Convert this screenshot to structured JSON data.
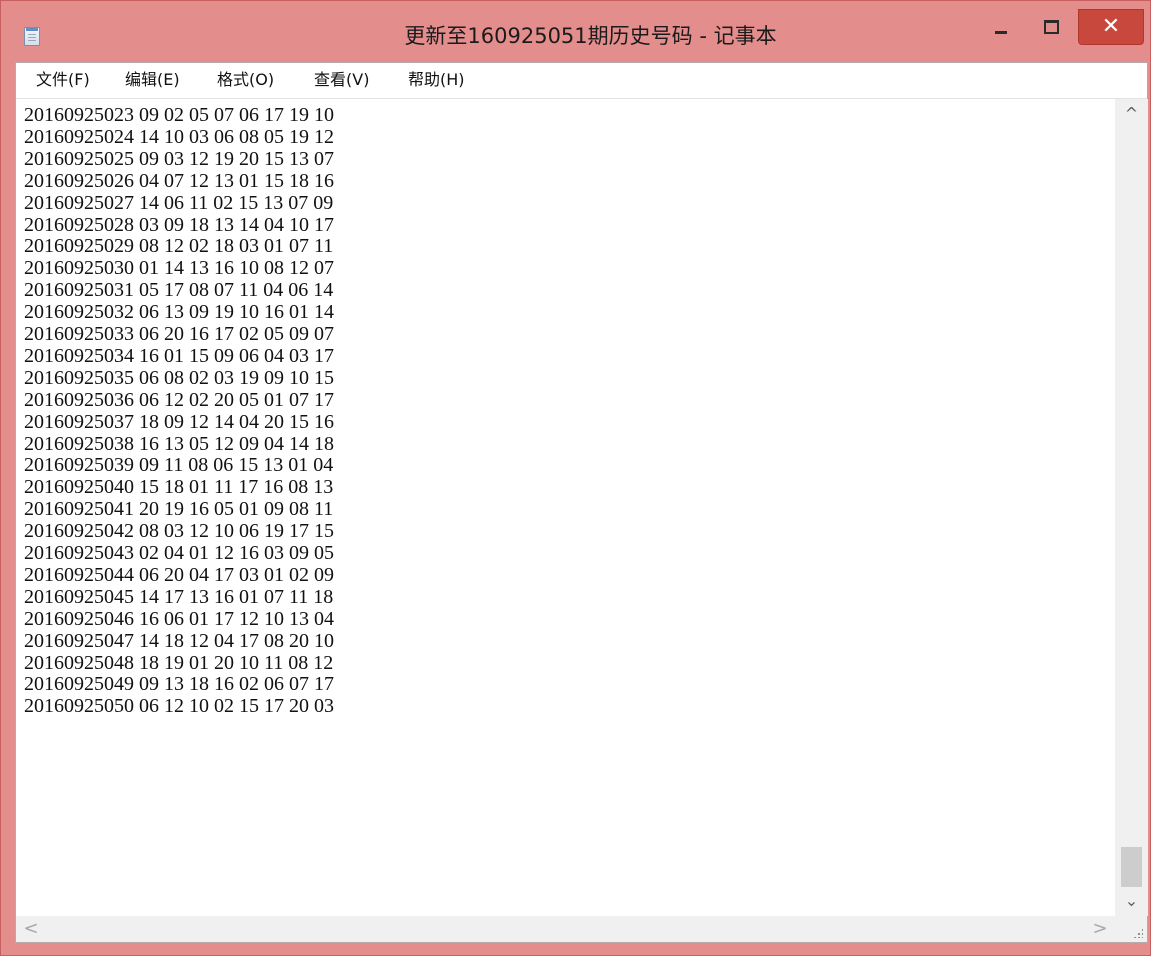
{
  "window": {
    "title": "更新至160925051期历史号码 - 记事本",
    "controls": {
      "minimize": "",
      "maximize": "",
      "close": "✕"
    }
  },
  "menu": [
    "文件(F)",
    "编辑(E)",
    "格式(O)",
    "查看(V)",
    "帮助(H)"
  ],
  "lines": [
    "20160925023 09 02 05 07 06 17 19 10",
    "20160925024 14 10 03 06 08 05 19 12",
    "20160925025 09 03 12 19 20 15 13 07",
    "20160925026 04 07 12 13 01 15 18 16",
    "20160925027 14 06 11 02 15 13 07 09",
    "20160925028 03 09 18 13 14 04 10 17",
    "20160925029 08 12 02 18 03 01 07 11",
    "20160925030 01 14 13 16 10 08 12 07",
    "20160925031 05 17 08 07 11 04 06 14",
    "20160925032 06 13 09 19 10 16 01 14",
    "20160925033 06 20 16 17 02 05 09 07",
    "20160925034 16 01 15 09 06 04 03 17",
    "20160925035 06 08 02 03 19 09 10 15",
    "20160925036 06 12 02 20 05 01 07 17",
    "20160925037 18 09 12 14 04 20 15 16",
    "20160925038 16 13 05 12 09 04 14 18",
    "20160925039 09 11 08 06 15 13 01 04",
    "20160925040 15 18 01 11 17 16 08 13",
    "20160925041 20 19 16 05 01 09 08 11",
    "20160925042 08 03 12 10 06 19 17 15",
    "20160925043 02 04 01 12 16 03 09 05",
    "20160925044 06 20 04 17 03 01 02 09",
    "20160925045 14 17 13 16 01 07 11 18",
    "20160925046 16 06 01 17 12 10 13 04",
    "20160925047 14 18 12 04 17 08 20 10",
    "20160925048 18 19 01 20 10 11 08 12",
    "20160925049 09 13 18 16 02 06 07 17",
    "20160925050 06 12 10 02 15 17 20 03"
  ],
  "scrollbars": {
    "up": "^",
    "down": "⌄",
    "left": "<",
    "right": ">"
  }
}
